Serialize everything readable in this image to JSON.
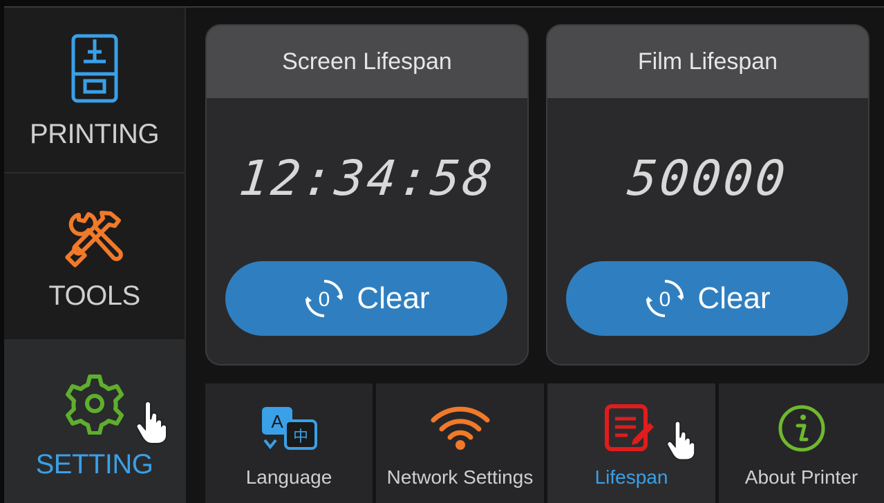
{
  "sidebar": {
    "items": [
      {
        "label": "PRINTING",
        "icon": "printer-icon"
      },
      {
        "label": "TOOLS",
        "icon": "tools-icon"
      },
      {
        "label": "SETTING",
        "icon": "gear-icon",
        "active": true
      }
    ]
  },
  "cards": {
    "screen": {
      "title": "Screen Lifespan",
      "value": "12:34:58",
      "button_label": "Clear"
    },
    "film": {
      "title": "Film Lifespan",
      "value": "50000",
      "button_label": "Clear"
    },
    "reset_glyph": "0"
  },
  "tabs": [
    {
      "label": "Language",
      "icon": "language-icon"
    },
    {
      "label": "Network Settings",
      "icon": "wifi-icon"
    },
    {
      "label": "Lifespan",
      "icon": "lifespan-icon",
      "active": true
    },
    {
      "label": "About Printer",
      "icon": "info-icon"
    }
  ],
  "colors": {
    "accent": "#3aa0e8",
    "button": "#2f7fc0",
    "printing_icon": "#3aa0e8",
    "tools_icon": "#f07a2a",
    "setting_icon": "#5fae2e",
    "wifi_icon": "#f07a2a",
    "lifespan_icon": "#e01c1c",
    "info_icon": "#6fb82e"
  }
}
